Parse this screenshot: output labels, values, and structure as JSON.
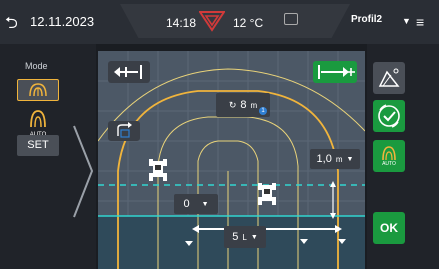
{
  "topbar": {
    "back_icon": "return-arrow-icon",
    "date": "12.11.2023",
    "time": "14:18",
    "logo_icon": "brand-triangle-logo-icon",
    "temperature": "12 °C",
    "keyboard_icon": "keyboard-icon",
    "profile": "Profil2",
    "profile_dropdown_icon": "chevron-down-icon",
    "menu_icon": "hamburger-menu-icon"
  },
  "left": {
    "mode_label": "Mode",
    "auto_label": "AUTO",
    "set_label": "SET"
  },
  "map": {
    "shift_left_icon": "shift-left-icon",
    "shift_right_icon": "shift-right-icon",
    "radius_value": "8",
    "radius_unit": "m",
    "radius_badge": "1",
    "offset_value": "1,0",
    "offset_unit": "m",
    "field_value": "0",
    "width_value": "5",
    "width_unit": "L"
  },
  "right": {
    "tool_icon": "terrain-tool-icon",
    "confirm_icon": "check-circle-icon",
    "auto_label": "AUTO",
    "ok_label": "OK"
  },
  "colors": {
    "accent_yellow": "#f0b43c",
    "ok_green": "#1a9a3f",
    "guide_cyan": "#31d6d0"
  }
}
